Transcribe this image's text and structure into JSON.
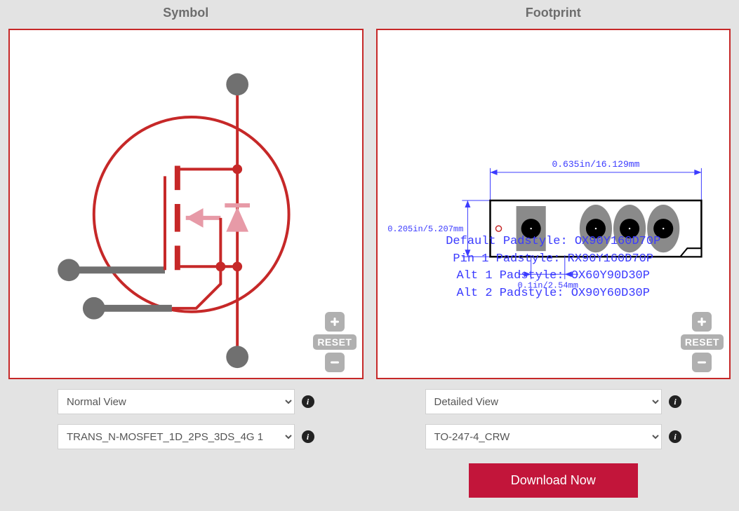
{
  "symbol": {
    "title": "Symbol",
    "reset_label": "RESET",
    "view_select": "Normal View",
    "part_select": "TRANS_N-MOSFET_1D_2PS_3DS_4G 1"
  },
  "footprint": {
    "title": "Footprint",
    "reset_label": "RESET",
    "view_select": "Detailed View",
    "part_select": "TO-247-4_CRW",
    "dim_top": "0.635in/16.129mm",
    "dim_left": "0.205in/5.207mm",
    "dim_bottom": "0.1in/2.54mm",
    "padstyles": [
      "Default Padstyle: OX90Y160D70P",
      "Pin 1 Padstyle: RX90Y160D70P",
      "Alt 1 Padstyle: OX60Y90D30P",
      "Alt 2 Padstyle: OX90Y60D30P"
    ]
  },
  "download_label": "Download Now"
}
